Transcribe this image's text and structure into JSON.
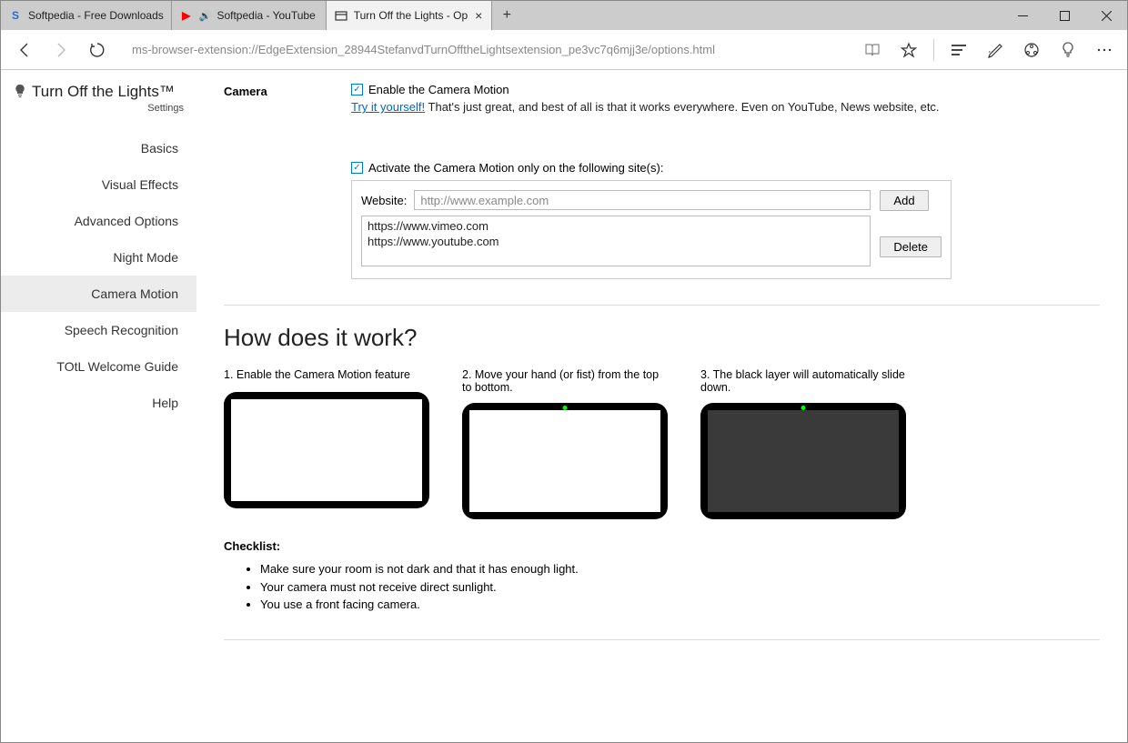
{
  "tabs": [
    {
      "favicon": "S",
      "favcolor": "#2a6fc9",
      "title": "Softpedia - Free Downloads"
    },
    {
      "favicon": "▶",
      "favcolor": "#ff0000",
      "muted": true,
      "title": "Softpedia - YouTube"
    },
    {
      "favicon": "□",
      "favcolor": "#555",
      "title": "Turn Off the Lights - Op",
      "active": true
    }
  ],
  "toolbar": {
    "url": "ms-browser-extension://EdgeExtension_28944StefanvdTurnOfftheLightsextension_pe3vc7q6mjj3e/options.html"
  },
  "brand": {
    "name": "Turn Off the Lights™",
    "sub": "Settings"
  },
  "nav": [
    {
      "label": "Basics"
    },
    {
      "label": "Visual Effects"
    },
    {
      "label": "Advanced Options"
    },
    {
      "label": "Night Mode"
    },
    {
      "label": "Camera Motion",
      "active": true
    },
    {
      "label": "Speech Recognition"
    },
    {
      "label": "TOtL Welcome Guide"
    },
    {
      "label": "Help"
    }
  ],
  "camera": {
    "section_title": "Camera",
    "enable_label": "Enable the Camera Motion",
    "try_link": "Try it yourself!",
    "try_desc": " That's just great, and best of all is that it works everywhere. Even on YouTube, News website, etc.",
    "activate_label": "Activate the Camera Motion only on the following site(s):",
    "website_label": "Website:",
    "website_placeholder": "http://www.example.com",
    "list_text": "https://www.vimeo.com\nhttps://www.youtube.com",
    "add_btn": "Add",
    "delete_btn": "Delete"
  },
  "howto": {
    "title": "How does it work?",
    "step1": "1. Enable the Camera Motion feature",
    "step2": "2. Move your hand (or fist) from the top to bottom.",
    "step3": "3. The black layer will automatically slide down.",
    "checklist_title": "Checklist:",
    "items": [
      "Make sure your room is not dark and that it has enough light.",
      "Your camera must not receive direct sunlight.",
      "You use a front facing camera."
    ]
  }
}
